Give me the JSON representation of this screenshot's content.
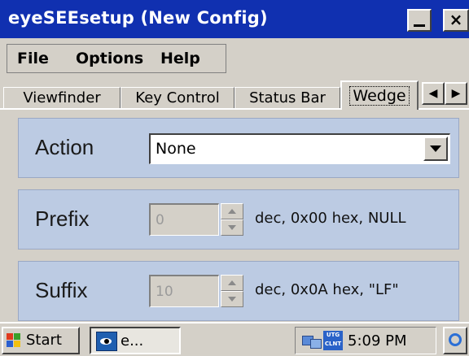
{
  "window": {
    "title": "eyeSEEsetup (New Config)",
    "minimize_label": "_",
    "close_label": "×"
  },
  "menu": {
    "items": [
      "File",
      "Options",
      "Help"
    ]
  },
  "tabs": {
    "items": [
      "Viewfinder",
      "Key Control",
      "Status Bar",
      "Wedge"
    ],
    "selected": "Wedge",
    "scroll_left": "◀",
    "scroll_right": "▶"
  },
  "wedge": {
    "action": {
      "label": "Action",
      "value": "None"
    },
    "prefix": {
      "label": "Prefix",
      "value": "0",
      "description": "dec, 0x00 hex, NULL"
    },
    "suffix": {
      "label": "Suffix",
      "value": "10",
      "description": "dec, 0x0A hex, \"LF\""
    }
  },
  "taskbar": {
    "start_label": "Start",
    "task_label": "e...",
    "tray_badge": "UTG CLNT",
    "clock": "5:09 PM"
  },
  "icons": {
    "start": "windows-flag-icon",
    "app": "eyeseesetup-app-icon",
    "network": "network-connection-icon",
    "client": "utg-client-icon",
    "desktop": "desktop-browser-icon"
  },
  "colors": {
    "titlebar": "#1030b0",
    "panel": "#bccbe3",
    "chrome": "#d4d0c8"
  }
}
